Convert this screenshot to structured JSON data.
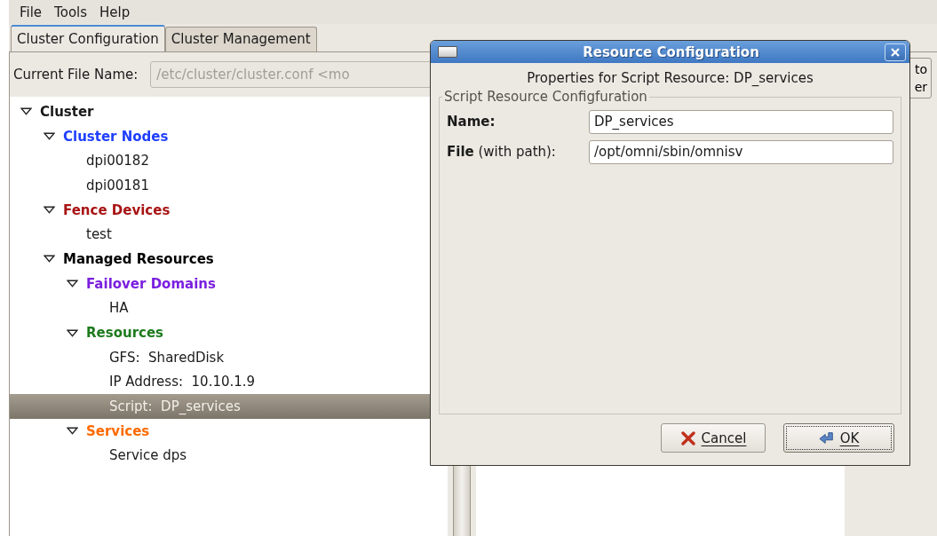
{
  "menu": [
    {
      "label": "File"
    },
    {
      "label": "Tools"
    },
    {
      "label": "Help"
    }
  ],
  "tabs": [
    {
      "label": "Cluster Configuration",
      "selected": true
    },
    {
      "label": "Cluster Management",
      "selected": false
    }
  ],
  "file_field": {
    "label": "Current File Name:",
    "value": "/etc/cluster/cluster.conf <mo",
    "disabled": true
  },
  "side_button": {
    "lines": [
      "to",
      "er"
    ]
  },
  "tree": [
    {
      "label": "Cluster",
      "bold": true,
      "expanded": true,
      "selected": false,
      "children": [
        {
          "label": "Cluster Nodes",
          "bold": true,
          "color": "#1f3fff",
          "expanded": true,
          "selected": false,
          "children": [
            {
              "label": "dpi00182",
              "selected": false
            },
            {
              "label": "dpi00181",
              "selected": false
            }
          ]
        },
        {
          "label": "Fence Devices",
          "bold": true,
          "color": "#a81414",
          "expanded": true,
          "selected": false,
          "children": [
            {
              "label": "test",
              "selected": false
            }
          ]
        },
        {
          "label": "Managed Resources",
          "bold": true,
          "color": "#000000",
          "expanded": true,
          "selected": false,
          "children": [
            {
              "label": "Failover Domains",
              "bold": true,
              "color": "#7a1fe0",
              "expanded": true,
              "selected": false,
              "children": [
                {
                  "label": "HA",
                  "selected": false
                }
              ]
            },
            {
              "label": "Resources",
              "bold": true,
              "color": "#1e7a1e",
              "expanded": true,
              "selected": false,
              "children": [
                {
                  "label": "GFS:  SharedDisk",
                  "selected": false
                },
                {
                  "label": "IP Address:  10.10.1.9",
                  "selected": false
                },
                {
                  "label": "Script:  DP_services",
                  "selected": true
                }
              ]
            },
            {
              "label": "Services",
              "bold": true,
              "color": "#ff6a00",
              "expanded": true,
              "selected": false,
              "children": [
                {
                  "label": "Service dps",
                  "selected": false
                }
              ]
            }
          ]
        }
      ]
    }
  ],
  "dialog": {
    "title": "Resource Configuration",
    "subtitle": "Properties for Script Resource: DP_services",
    "frame_title": "Script Resource Configfuration",
    "fields": [
      {
        "label": "**Name:**",
        "value": "DP_services"
      },
      {
        "label": "**File** (with path):",
        "value": "/opt/omni/sbin/omnisv"
      }
    ],
    "buttons": [
      {
        "label": "Cancel",
        "kind": "cancel",
        "focused": false
      },
      {
        "label": "OK",
        "kind": "ok",
        "focused": true
      }
    ]
  }
}
